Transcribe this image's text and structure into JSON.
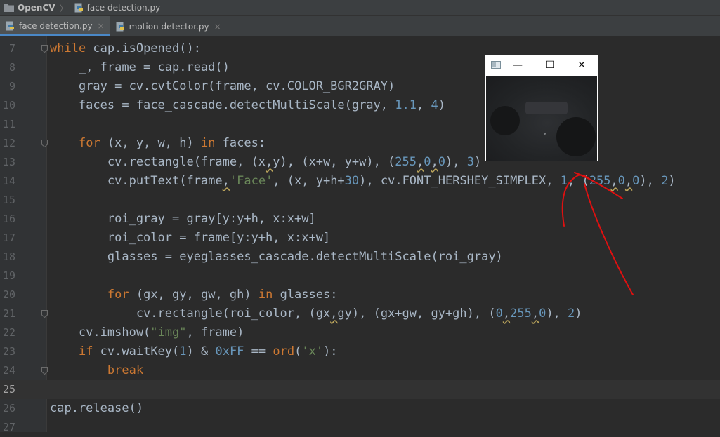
{
  "breadcrumb": {
    "project": "OpenCV",
    "file": "face detection.py"
  },
  "tabs": [
    {
      "label": "face detection.py",
      "active": true
    },
    {
      "label": "motion detector.py",
      "active": false
    }
  ],
  "tab_close_glyph": "×",
  "editor": {
    "current_line": 25,
    "lines": [
      {
        "n": "7",
        "tokens": [
          [
            "kw",
            "while"
          ],
          [
            "t",
            " cap.isOpened():"
          ]
        ]
      },
      {
        "n": "8",
        "tokens": [
          [
            "t",
            "    _, frame = cap.read()"
          ]
        ]
      },
      {
        "n": "9",
        "tokens": [
          [
            "t",
            "    gray = cv.cvtColor(frame, cv.COLOR_BGR2GRAY)"
          ]
        ]
      },
      {
        "n": "10",
        "tokens": [
          [
            "t",
            "    faces = face_cascade.detectMultiScale(gray, "
          ],
          [
            "num",
            "1.1"
          ],
          [
            "t",
            ", "
          ],
          [
            "num",
            "4"
          ],
          [
            "t",
            ")"
          ]
        ]
      },
      {
        "n": "11",
        "tokens": []
      },
      {
        "n": "12",
        "tokens": [
          [
            "t",
            "    "
          ],
          [
            "kw",
            "for"
          ],
          [
            "t",
            " (x, y, w, h) "
          ],
          [
            "kw",
            "in"
          ],
          [
            "t",
            " faces:"
          ]
        ]
      },
      {
        "n": "13",
        "tokens": [
          [
            "t",
            "        cv.rectangle(frame, (x"
          ],
          [
            "sq",
            ","
          ],
          [
            "t",
            "y), (x+w, y+w), ("
          ],
          [
            "num",
            "255"
          ],
          [
            "sq",
            ","
          ],
          [
            "num",
            "0"
          ],
          [
            "sq",
            ","
          ],
          [
            "num",
            "0"
          ],
          [
            "t",
            "), "
          ],
          [
            "num",
            "3"
          ],
          [
            "t",
            ")"
          ]
        ]
      },
      {
        "n": "14",
        "tokens": [
          [
            "t",
            "        cv.putText(frame"
          ],
          [
            "sq",
            ","
          ],
          [
            "str",
            "'Face'"
          ],
          [
            "t",
            ", (x, y+h+"
          ],
          [
            "num",
            "30"
          ],
          [
            "t",
            "), cv.FONT_HERSHEY_SIMPLEX, "
          ],
          [
            "num",
            "1"
          ],
          [
            "t",
            ", ("
          ],
          [
            "num",
            "255"
          ],
          [
            "sq",
            ","
          ],
          [
            "num",
            "0"
          ],
          [
            "sq",
            ","
          ],
          [
            "num",
            "0"
          ],
          [
            "t",
            "), "
          ],
          [
            "num",
            "2"
          ],
          [
            "t",
            ")"
          ]
        ]
      },
      {
        "n": "15",
        "tokens": []
      },
      {
        "n": "16",
        "tokens": [
          [
            "t",
            "        roi_gray = gray[y:y+h, x:x+w]"
          ]
        ]
      },
      {
        "n": "17",
        "tokens": [
          [
            "t",
            "        roi_color = frame[y:y+h, x:x+w]"
          ]
        ]
      },
      {
        "n": "18",
        "tokens": [
          [
            "t",
            "        glasses = eyeglasses_cascade.detectMultiScale(roi_gray)"
          ]
        ]
      },
      {
        "n": "19",
        "tokens": []
      },
      {
        "n": "20",
        "tokens": [
          [
            "t",
            "        "
          ],
          [
            "kw",
            "for"
          ],
          [
            "t",
            " (gx, gy, gw, gh) "
          ],
          [
            "kw",
            "in"
          ],
          [
            "t",
            " glasses:"
          ]
        ]
      },
      {
        "n": "21",
        "tokens": [
          [
            "t",
            "            cv.rectangle(roi_color, (gx"
          ],
          [
            "sq",
            ","
          ],
          [
            "t",
            "gy), (gx+gw, gy+gh), ("
          ],
          [
            "num",
            "0"
          ],
          [
            "sq",
            ","
          ],
          [
            "num",
            "255"
          ],
          [
            "sq",
            ","
          ],
          [
            "num",
            "0"
          ],
          [
            "t",
            "), "
          ],
          [
            "num",
            "2"
          ],
          [
            "t",
            ")"
          ]
        ]
      },
      {
        "n": "22",
        "tokens": [
          [
            "t",
            "    cv.imshow("
          ],
          [
            "str",
            "\"img\""
          ],
          [
            "t",
            ", frame)"
          ]
        ]
      },
      {
        "n": "23",
        "tokens": [
          [
            "t",
            "    "
          ],
          [
            "kw",
            "if"
          ],
          [
            "t",
            " cv.waitKey("
          ],
          [
            "num",
            "1"
          ],
          [
            "t",
            ") & "
          ],
          [
            "num",
            "0xFF"
          ],
          [
            "t",
            " == "
          ],
          [
            "kw",
            "ord"
          ],
          [
            "t",
            "("
          ],
          [
            "str",
            "'x'"
          ],
          [
            "t",
            "):"
          ]
        ]
      },
      {
        "n": "24",
        "tokens": [
          [
            "t",
            "        "
          ],
          [
            "kw",
            "break"
          ]
        ]
      },
      {
        "n": "25",
        "tokens": []
      },
      {
        "n": "26",
        "tokens": [
          [
            "t",
            "cap.release()"
          ]
        ]
      },
      {
        "n": "27",
        "tokens": []
      }
    ]
  },
  "image_window": {
    "minimize_glyph": "—",
    "maximize_glyph": "☐",
    "close_glyph": "✕"
  },
  "colors": {
    "annotation": "#e01010",
    "keyword": "#cc7832",
    "number": "#6897bb",
    "string": "#6a8759"
  },
  "icons": [
    "folder-icon",
    "python-file-icon",
    "window-app-icon"
  ]
}
